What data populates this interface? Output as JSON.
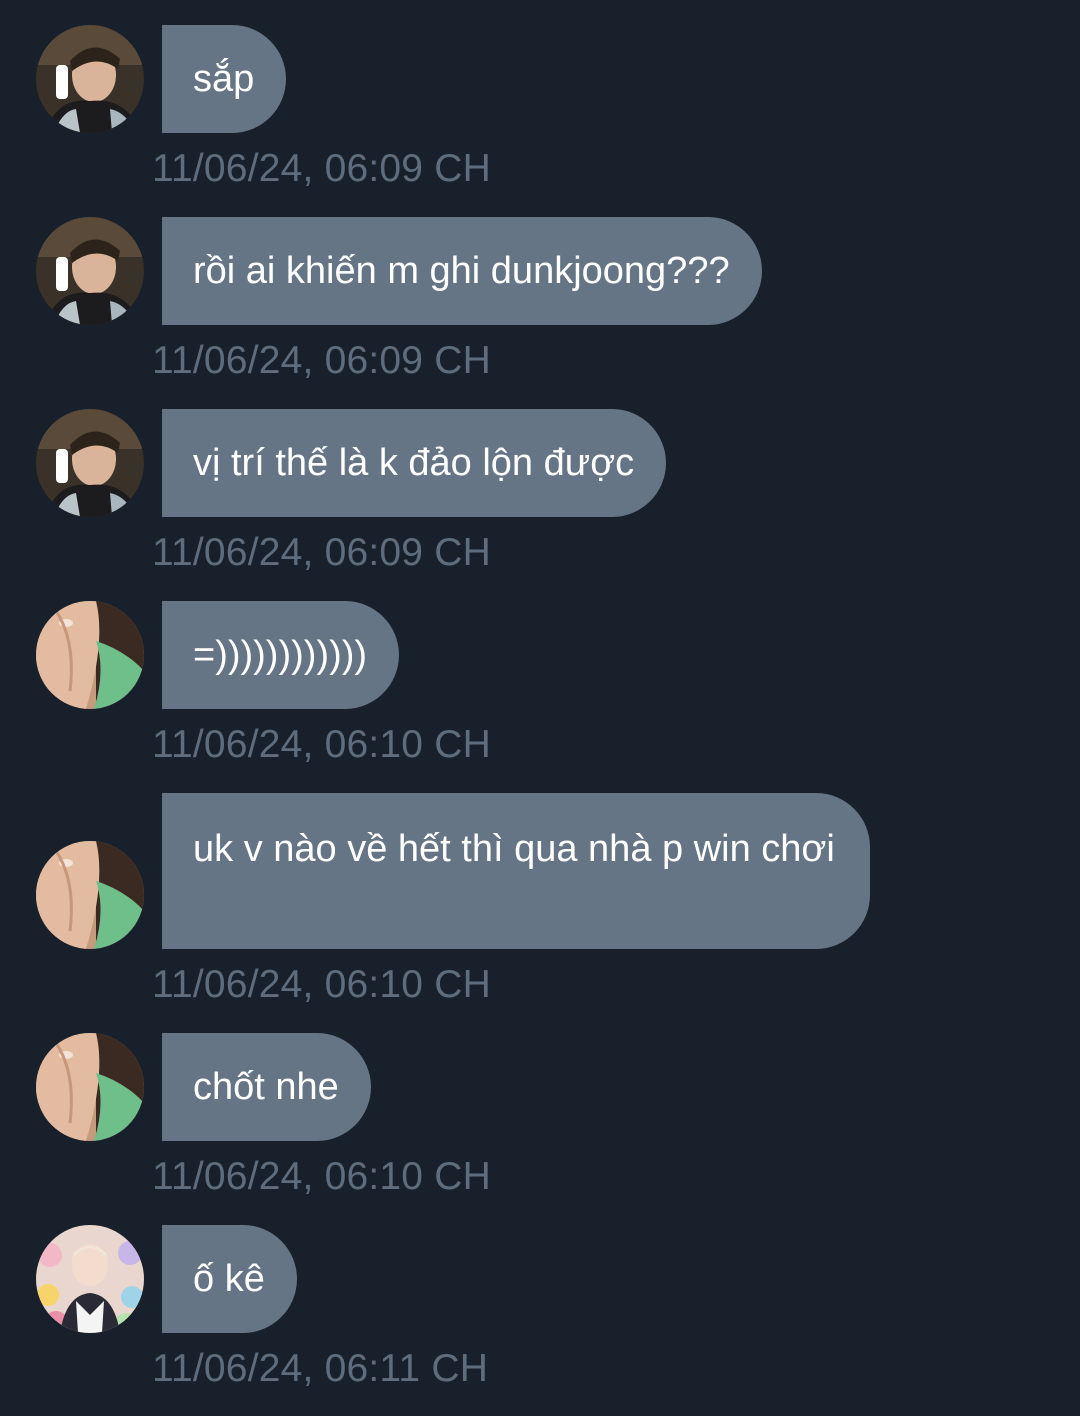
{
  "messages": [
    {
      "sender": "avatar-a",
      "text": "sắp",
      "time": "11/06/24, 06:09 CH"
    },
    {
      "sender": "avatar-a",
      "text": "rồi ai khiến m ghi dunkjoong???",
      "time": "11/06/24, 06:09 CH"
    },
    {
      "sender": "avatar-a",
      "text": "vị trí thế là k đảo lộn được",
      "time": "11/06/24, 06:09 CH"
    },
    {
      "sender": "avatar-b",
      "text": "=))))))))))))",
      "time": "11/06/24, 06:10 CH"
    },
    {
      "sender": "avatar-b",
      "text": "uk v nào về hết thì qua nhà p win chơi",
      "time": "11/06/24, 06:10 CH"
    },
    {
      "sender": "avatar-b",
      "text": "chốt nhe",
      "time": "11/06/24, 06:10 CH"
    },
    {
      "sender": "avatar-c",
      "text": "ố kê",
      "time": "11/06/24, 06:11 CH"
    }
  ],
  "colors": {
    "background": "#18202b",
    "bubble": "#657585",
    "bubble_text": "#ffffff",
    "timestamp": "#5e6d7d"
  }
}
